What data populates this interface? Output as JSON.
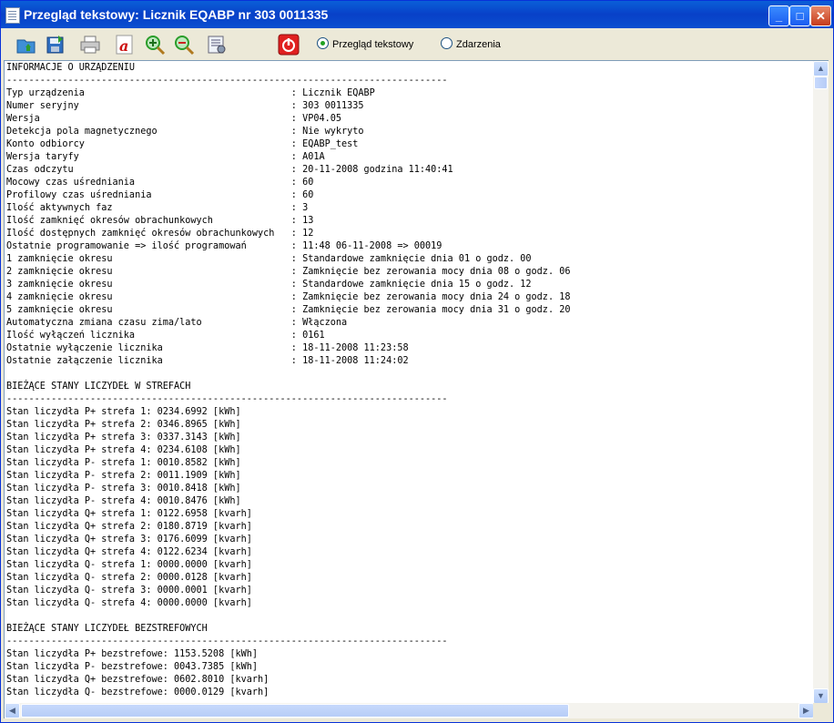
{
  "window": {
    "title": "Przegląd tekstowy: Licznik EQABP nr 303 0011335",
    "controls": {
      "minimize": "_",
      "maximize": "□",
      "close": "✕"
    }
  },
  "toolbar": {
    "icons": [
      "open-icon",
      "save-icon",
      "print-icon",
      "pdf-icon",
      "zoom-in-icon",
      "zoom-out-icon",
      "settings-icon",
      "power-icon"
    ],
    "colors": {
      "power": "#e02020",
      "zoom": "#2a9d2a",
      "pdf": "#cc1111"
    },
    "view_options": {
      "text_view_label": "Przegląd tekstowy",
      "events_label": "Zdarzenia",
      "selected": "Przegląd tekstowy"
    }
  },
  "report": {
    "lines": [
      "INFORMACJE O URZĄDZENIU",
      "-------------------------------------------------------------------------------",
      "Typ urządzenia                                     : Licznik EQABP",
      "Numer seryjny                                      : 303 0011335",
      "Wersja                                             : VP04.05",
      "Detekcja pola magnetycznego                        : Nie wykryto",
      "Konto odbiorcy                                     : EQABP_test",
      "Wersja taryfy                                      : A01A",
      "Czas odczytu                                       : 20-11-2008 godzina 11:40:41",
      "Mocowy czas uśredniania                            : 60",
      "Profilowy czas uśredniania                         : 60",
      "Ilość aktywnych faz                                : 3",
      "Ilość zamknięć okresów obrachunkowych              : 13",
      "Ilość dostępnych zamknięć okresów obrachunkowych   : 12",
      "Ostatnie programowanie => ilość programowań        : 11:48 06-11-2008 => 00019",
      "1 zamknięcie okresu                                : Standardowe zamknięcie dnia 01 o godz. 00",
      "2 zamknięcie okresu                                : Zamknięcie bez zerowania mocy dnia 08 o godz. 06",
      "3 zamknięcie okresu                                : Standardowe zamknięcie dnia 15 o godz. 12",
      "4 zamknięcie okresu                                : Zamknięcie bez zerowania mocy dnia 24 o godz. 18",
      "5 zamknięcie okresu                                : Zamknięcie bez zerowania mocy dnia 31 o godz. 20",
      "Automatyczna zmiana czasu zima/lato                : Włączona",
      "Ilość wyłączeń licznika                            : 0161",
      "Ostatnie wyłączenie licznika                       : 18-11-2008 11:23:58",
      "Ostatnie załączenie licznika                       : 18-11-2008 11:24:02",
      "",
      "BIEŻĄCE STANY LICZYDEŁ W STREFACH",
      "-------------------------------------------------------------------------------",
      "Stan liczydła P+ strefa 1: 0234.6992 [kWh]",
      "Stan liczydła P+ strefa 2: 0346.8965 [kWh]",
      "Stan liczydła P+ strefa 3: 0337.3143 [kWh]",
      "Stan liczydła P+ strefa 4: 0234.6108 [kWh]",
      "Stan liczydła P- strefa 1: 0010.8582 [kWh]",
      "Stan liczydła P- strefa 2: 0011.1909 [kWh]",
      "Stan liczydła P- strefa 3: 0010.8418 [kWh]",
      "Stan liczydła P- strefa 4: 0010.8476 [kWh]",
      "Stan liczydła Q+ strefa 1: 0122.6958 [kvarh]",
      "Stan liczydła Q+ strefa 2: 0180.8719 [kvarh]",
      "Stan liczydła Q+ strefa 3: 0176.6099 [kvarh]",
      "Stan liczydła Q+ strefa 4: 0122.6234 [kvarh]",
      "Stan liczydła Q- strefa 1: 0000.0000 [kvarh]",
      "Stan liczydła Q- strefa 2: 0000.0128 [kvarh]",
      "Stan liczydła Q- strefa 3: 0000.0001 [kvarh]",
      "Stan liczydła Q- strefa 4: 0000.0000 [kvarh]",
      "",
      "BIEŻĄCE STANY LICZYDEŁ BEZSTREFOWYCH",
      "-------------------------------------------------------------------------------",
      "Stan liczydła P+ bezstrefowe: 1153.5208 [kWh]",
      "Stan liczydła P- bezstrefowe: 0043.7385 [kWh]",
      "Stan liczydła Q+ bezstrefowe: 0602.8010 [kvarh]",
      "Stan liczydła Q- bezstrefowe: 0000.0129 [kvarh]"
    ]
  },
  "scrollbars": {
    "up": "▲",
    "down": "▼",
    "left": "◀",
    "right": "▶"
  }
}
